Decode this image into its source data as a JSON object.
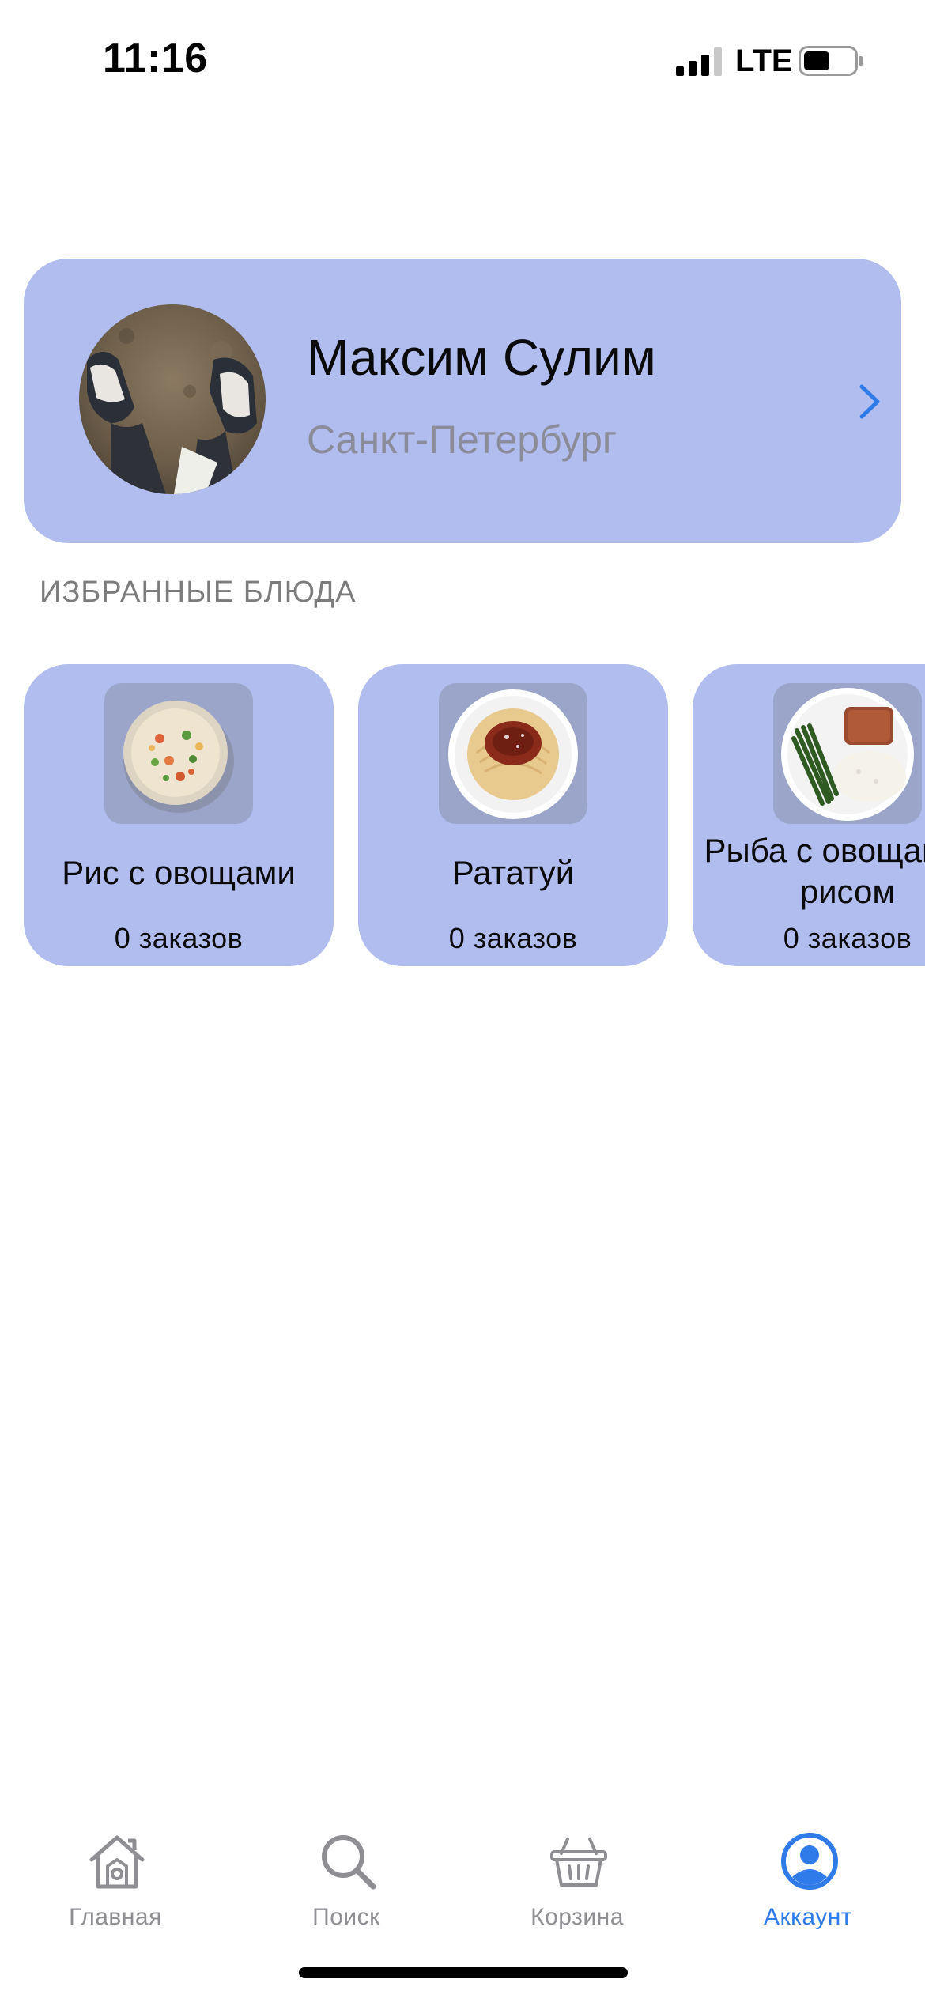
{
  "status_bar": {
    "time": "11:16",
    "network": "LTE",
    "signal_icon": "cellular-signal-icon",
    "battery_icon": "battery-icon"
  },
  "profile": {
    "name": "Максим Сулим",
    "city": "Санкт-Петербург",
    "avatar_icon": "avatar-photo",
    "chevron_icon": "chevron-right-icon"
  },
  "favorites": {
    "title": "ИЗБРАННЫЕ БЛЮДА",
    "items": [
      {
        "name": "Рис с овощами",
        "orders": "0 заказов",
        "image_icon": "rice-with-vegetables-image"
      },
      {
        "name": "Рататуй",
        "orders": "0 заказов",
        "image_icon": "spaghetti-image"
      },
      {
        "name": "Рыба с овощами и рисом",
        "orders": "0 заказов",
        "image_icon": "fish-with-vegetables-image"
      }
    ]
  },
  "tab_bar": {
    "tabs": [
      {
        "label": "Главная",
        "icon": "house-icon",
        "active": false
      },
      {
        "label": "Поиск",
        "icon": "magnifier-icon",
        "active": false
      },
      {
        "label": "Корзина",
        "icon": "basket-icon",
        "active": false
      },
      {
        "label": "Аккаунт",
        "icon": "account-icon",
        "active": true
      }
    ]
  },
  "colors": {
    "card_background": "#b0bdee",
    "thumb_background": "#9aa5c9",
    "accent": "#2f7bea",
    "inactive_tab": "#8e8e93",
    "secondary_text": "#8a8d99"
  }
}
